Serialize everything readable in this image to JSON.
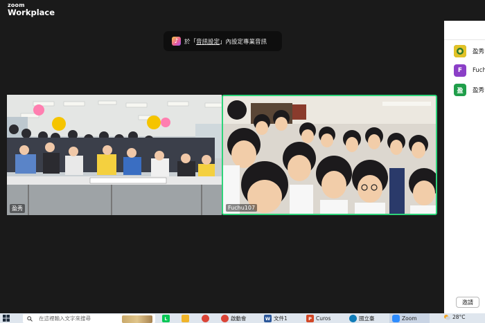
{
  "window": {
    "brand_top": "zoom",
    "brand_bottom": "Workplace"
  },
  "notice": {
    "prefix": "於「",
    "link": "音訊設定",
    "suffix": "」內設定專業音訊",
    "icon": "music-note-icon"
  },
  "videos": [
    {
      "name": "盈秀",
      "active_speaker": false
    },
    {
      "name": "Fuchu107",
      "active_speaker": true,
      "border_color": "#2ed47a"
    }
  ],
  "participants": {
    "items": [
      {
        "name": "盈秀",
        "avatar": "photo",
        "avatar_color": "#e2c227"
      },
      {
        "name": "Fuchu",
        "avatar": "F",
        "avatar_color": "#8b3fc7"
      },
      {
        "name": "盈秀",
        "avatar": "盈",
        "avatar_color": "#1f9e4a"
      }
    ],
    "invite_label": "邀請"
  },
  "taskbar": {
    "search_placeholder": "在這裡輸入文字來搜尋",
    "apps": [
      {
        "label": "",
        "icon": "line-icon",
        "color": "#06c755"
      },
      {
        "label": "",
        "icon": "folder-icon",
        "color": "#f0b429"
      },
      {
        "label": "",
        "icon": "chrome-icon",
        "color": "#db4437"
      },
      {
        "label": "啟動會",
        "icon": "chrome-icon",
        "color": "#db4437"
      },
      {
        "label": "文件1",
        "icon": "word-icon",
        "color": "#2b579a"
      },
      {
        "label": "Curos",
        "icon": "powerpoint-icon",
        "color": "#d24726"
      },
      {
        "label": "國立臺",
        "icon": "edge-icon",
        "color": "#0f7cb8"
      },
      {
        "label": "Zoom",
        "icon": "zoom-icon",
        "color": "#2d8cff"
      }
    ],
    "temperature": "28°C"
  }
}
